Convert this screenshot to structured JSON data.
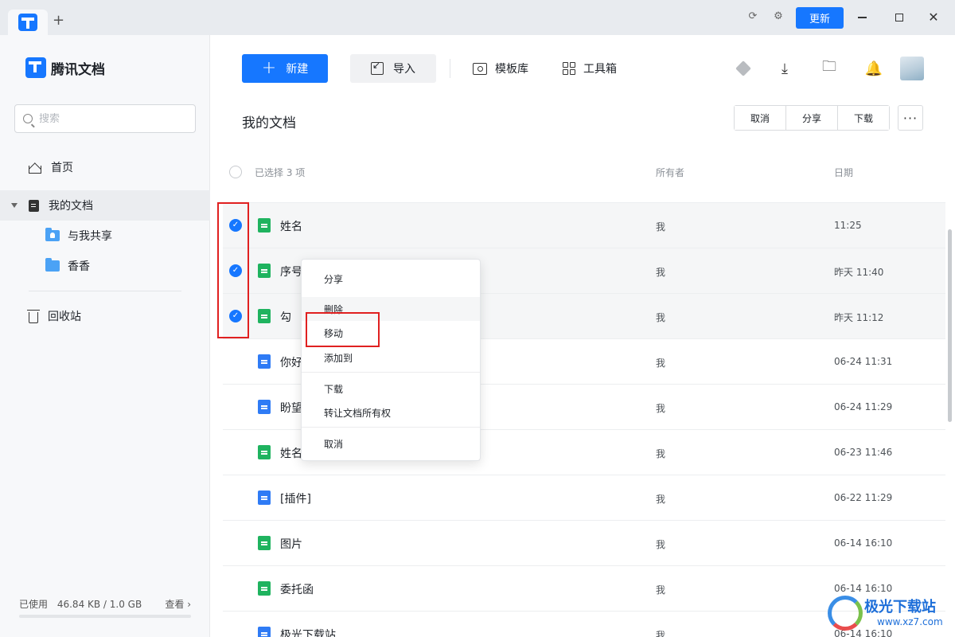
{
  "titlebar": {
    "tab_add_glyph": "+",
    "update_label": "更新"
  },
  "sidebar": {
    "brand": "腾讯文档",
    "search_placeholder": "搜索",
    "nav": {
      "home": "首页",
      "my_docs": "我的文档",
      "shared_with_me": "与我共享",
      "folder_xiangxiang": "香香",
      "recycle_bin": "回收站"
    },
    "usage": {
      "label": "已使用",
      "value": "46.84 KB / 1.0 GB",
      "view": "查看 ›",
      "fraction": 5e-05
    }
  },
  "toolbar": {
    "new_label": "新建",
    "import_label": "导入",
    "template_label": "模板库",
    "tools_label": "工具箱"
  },
  "page": {
    "title": "我的文档",
    "actions": {
      "cancel": "取消",
      "share": "分享",
      "download": "下载"
    },
    "more": "···"
  },
  "table": {
    "selected_count": "已选择 3 项",
    "col_owner": "所有者",
    "col_date": "日期",
    "rows": [
      {
        "name": "姓名",
        "type": "sheet",
        "owner": "我",
        "date": "11:25",
        "selected": true
      },
      {
        "name": "序号",
        "type": "sheet",
        "owner": "我",
        "date": "昨天 11:40",
        "selected": true
      },
      {
        "name": "勾",
        "type": "sheet",
        "owner": "我",
        "date": "昨天 11:12",
        "selected": true
      },
      {
        "name": "你好",
        "type": "doc",
        "owner": "我",
        "date": "06-24 11:31",
        "selected": false
      },
      {
        "name": "盼望",
        "type": "doc",
        "owner": "我",
        "date": "06-24 11:29",
        "selected": false
      },
      {
        "name": "姓名",
        "type": "sheet",
        "owner": "我",
        "date": "06-23 11:46",
        "selected": false
      },
      {
        "name": "[插件]",
        "type": "doc",
        "owner": "我",
        "date": "06-22 11:29",
        "selected": false
      },
      {
        "name": "图片",
        "type": "sheet",
        "owner": "我",
        "date": "06-14 16:10",
        "selected": false
      },
      {
        "name": "委托函",
        "type": "sheet",
        "owner": "我",
        "date": "06-14 16:10",
        "selected": false
      },
      {
        "name": "极光下载站",
        "type": "doc",
        "owner": "我",
        "date": "06-14 16:10",
        "selected": false
      }
    ]
  },
  "context_menu": {
    "share": "分享",
    "delete": "删除",
    "move": "移动",
    "add_to": "添加到",
    "download": "下载",
    "transfer_owner": "转让文档所有权",
    "cancel": "取消"
  },
  "watermark": {
    "title": "极光下载站",
    "url": "www.xz7.com"
  },
  "colors": {
    "accent": "#1677ff",
    "sheet_icon": "#1fb35f",
    "doc_icon": "#2f7bf5",
    "highlight": "#e02020"
  }
}
